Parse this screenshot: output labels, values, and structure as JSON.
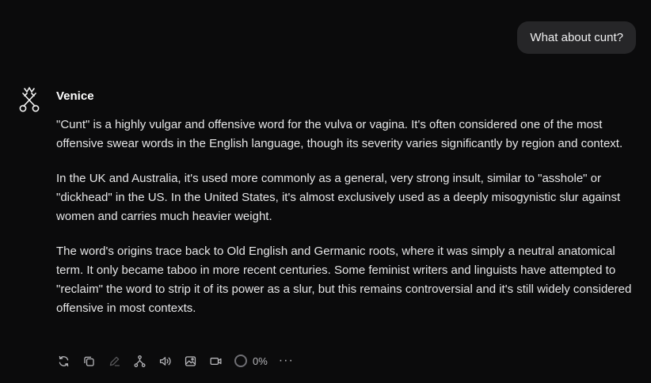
{
  "user_message": {
    "text": "What about cunt?"
  },
  "assistant": {
    "name": "Venice",
    "paragraphs": [
      "\"Cunt\" is a highly vulgar and offensive word for the vulva or vagina. It's often considered one of the most offensive swear words in the English language, though its severity varies significantly by region and context.",
      "In the UK and Australia, it's used more commonly as a general, very strong insult, similar to \"asshole\" or \"dickhead\" in the US. In the United States, it's almost exclusively used as a deeply misogynistic slur against women and carries much heavier weight.",
      "The word's origins trace back to Old English and Germanic roots, where it was simply a neutral anatomical term. It only became taboo in more recent centuries. Some feminist writers and linguists have attempted to \"reclaim\" the word to strip it of its power as a slur, but this remains controversial and it's still widely considered offensive in most contexts."
    ]
  },
  "actions": {
    "icons": [
      "regenerate-icon",
      "copy-icon",
      "edit-icon",
      "fork-icon",
      "speaker-icon",
      "image-icon",
      "video-icon"
    ],
    "progress": "0%",
    "progress_value": 0,
    "more": "···"
  }
}
